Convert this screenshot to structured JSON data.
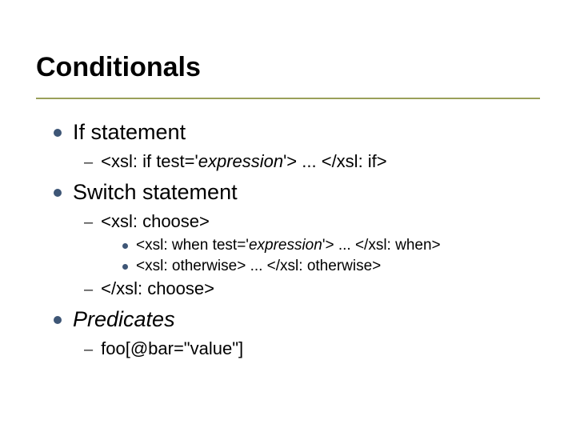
{
  "title": "Conditionals",
  "b1": "If statement",
  "b1_1a": "<xsl: if test='",
  "b1_1b": "expression",
  "b1_1c": "'> ... </xsl: if>",
  "b2": "Switch statement",
  "b2_1": "<xsl: choose>",
  "b2_1_1a": "<xsl: when test='",
  "b2_1_1b": "expression",
  "b2_1_1c": "'> ... </xsl: when>",
  "b2_1_2": "<xsl: otherwise> ... </xsl: otherwise>",
  "b2_2": "</xsl: choose>",
  "b3": "Predicates",
  "b3_1": "foo[@bar=\"value\"]"
}
